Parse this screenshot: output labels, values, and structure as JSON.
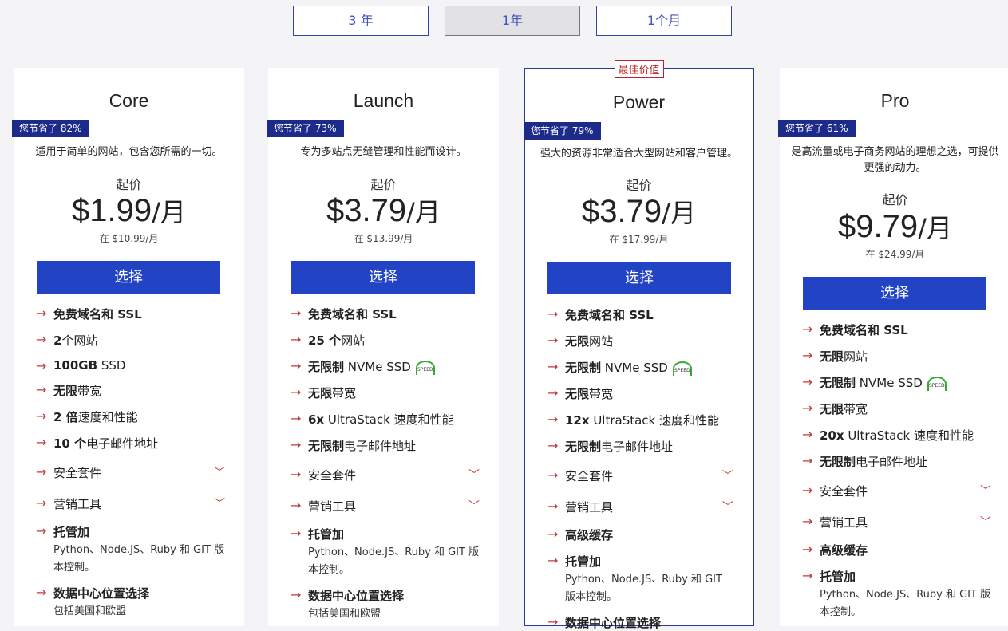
{
  "tabs": [
    {
      "label": "3 年"
    },
    {
      "label": "1年"
    },
    {
      "label": "1个月"
    }
  ],
  "best_value_label": "最佳价值",
  "common": {
    "from_label": "起价",
    "select_label": "选择",
    "speed_icon_text": "SPEED"
  },
  "plans": [
    {
      "name": "Core",
      "save": "您节省了 82%",
      "desc": "适用于简单的网站，包含您所需的一切。",
      "price": "$1.99",
      "per": "/月",
      "orig": "在 $10.99/月",
      "features": [
        {
          "strong": "免费域名和 SSL",
          "text": ""
        },
        {
          "strong": "2",
          "text": "个网站"
        },
        {
          "strong": "100GB",
          "text": " SSD"
        },
        {
          "strong": "无限",
          "text": "带宽"
        },
        {
          "strong": "2 倍",
          "text": "速度和性能"
        },
        {
          "strong": "10 个",
          "text": "电子邮件地址"
        },
        {
          "strong": "",
          "text": "安全套件"
        },
        {
          "strong": "",
          "text": "营销工具"
        },
        {
          "strong": "托管加",
          "text": "",
          "sub": "Python、Node.JS、Ruby 和 GIT 版本控制。"
        },
        {
          "strong": "数据中心位置选择",
          "text": "",
          "sub": "包括美国和欧盟"
        }
      ]
    },
    {
      "name": "Launch",
      "save": "您节省了 73%",
      "desc": "专为多站点无缝管理和性能而设计。",
      "price": "$3.79",
      "per": "/月",
      "orig": "在 $13.99/月",
      "features": [
        {
          "strong": "免费域名和 SSL",
          "text": ""
        },
        {
          "strong": "25 个",
          "text": "网站"
        },
        {
          "strong": "无限制",
          "text": " NVMe SSD"
        },
        {
          "strong": "无限",
          "text": "带宽"
        },
        {
          "strong": "6x",
          "text": " UltraStack 速度和性能"
        },
        {
          "strong": "无限制",
          "text": "电子邮件地址"
        },
        {
          "strong": "",
          "text": "安全套件"
        },
        {
          "strong": "",
          "text": "营销工具"
        },
        {
          "strong": "托管加",
          "text": "",
          "sub": "Python、Node.JS、Ruby 和 GIT 版本控制。"
        },
        {
          "strong": "数据中心位置选择",
          "text": "",
          "sub": "包括美国和欧盟"
        }
      ]
    },
    {
      "name": "Power",
      "save": "您节省了 79%",
      "desc": "强大的资源非常适合大型网站和客户管理。",
      "price": "$3.79",
      "per": "/月",
      "orig": "在 $17.99/月",
      "features": [
        {
          "strong": "免费域名和 SSL",
          "text": ""
        },
        {
          "strong": "无限",
          "text": "网站"
        },
        {
          "strong": "无限制",
          "text": " NVMe SSD"
        },
        {
          "strong": "无限",
          "text": "带宽"
        },
        {
          "strong": "12x",
          "text": " UltraStack 速度和性能"
        },
        {
          "strong": "无限制",
          "text": "电子邮件地址"
        },
        {
          "strong": "",
          "text": "安全套件"
        },
        {
          "strong": "",
          "text": "营销工具"
        },
        {
          "strong": "高级缓存",
          "text": ""
        },
        {
          "strong": "托管加",
          "text": "",
          "sub": "Python、Node.JS、Ruby 和 GIT 版本控制。"
        },
        {
          "strong": "数据中心位置选择",
          "text": ""
        }
      ]
    },
    {
      "name": "Pro",
      "save": "您节省了 61%",
      "desc": "是高流量或电子商务网站的理想之选，可提供更强的动力。",
      "price": "$9.79",
      "per": "/月",
      "orig": "在 $24.99/月",
      "features": [
        {
          "strong": "免费域名和 SSL",
          "text": ""
        },
        {
          "strong": "无限",
          "text": "网站"
        },
        {
          "strong": "无限制",
          "text": " NVMe SSD"
        },
        {
          "strong": "无限",
          "text": "带宽"
        },
        {
          "strong": "20x",
          "text": " UltraStack 速度和性能"
        },
        {
          "strong": "无限制",
          "text": "电子邮件地址"
        },
        {
          "strong": "",
          "text": "安全套件"
        },
        {
          "strong": "",
          "text": "营销工具"
        },
        {
          "strong": "高级缓存",
          "text": ""
        },
        {
          "strong": "托管加",
          "text": "",
          "sub": "Python、Node.JS、Ruby 和 GIT 版本控制。"
        }
      ]
    }
  ]
}
